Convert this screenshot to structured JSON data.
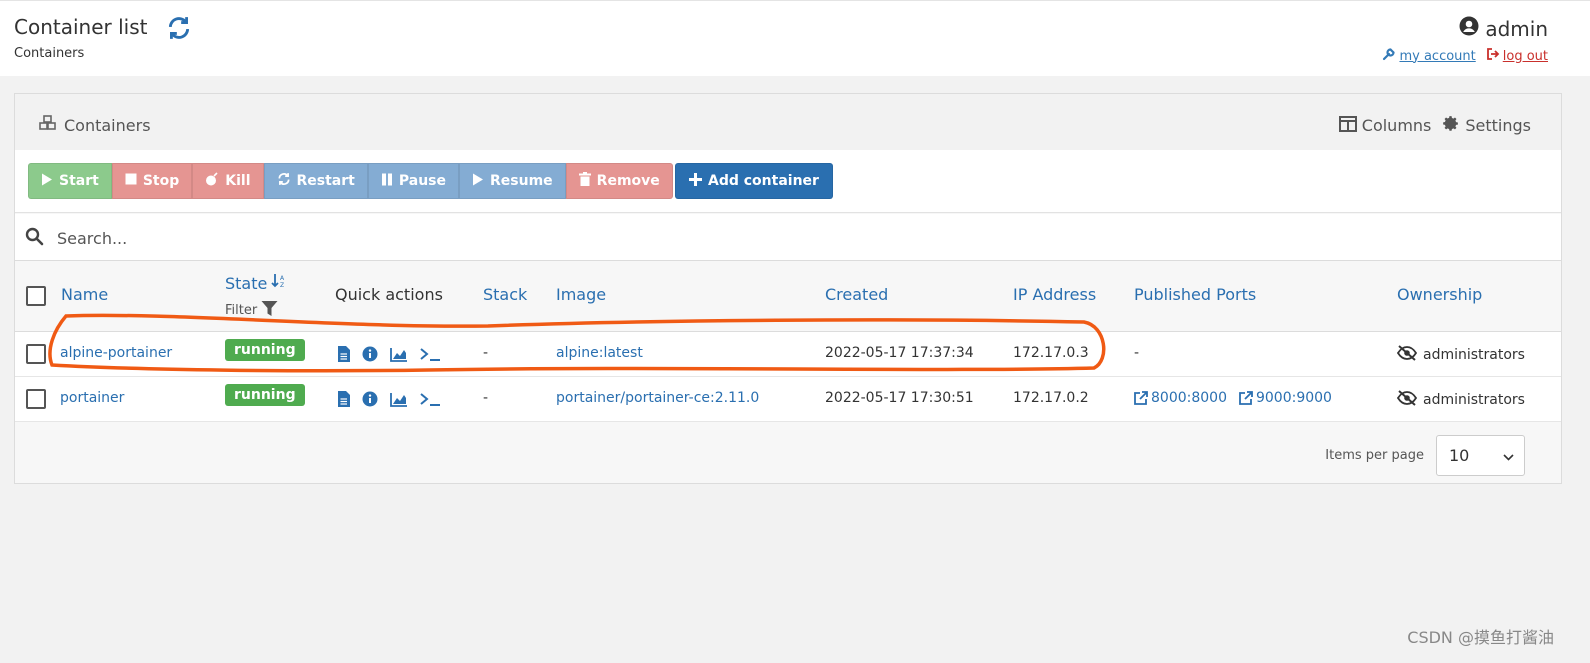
{
  "header": {
    "title": "Container list",
    "subtitle": "Containers",
    "user": "admin",
    "my_account": "my account",
    "log_out": "log out"
  },
  "panel": {
    "title": "Containers",
    "columns_label": "Columns",
    "settings_label": "Settings"
  },
  "toolbar": {
    "start": "Start",
    "stop": "Stop",
    "kill": "Kill",
    "restart": "Restart",
    "pause": "Pause",
    "resume": "Resume",
    "remove": "Remove",
    "add_container": "Add container"
  },
  "search": {
    "placeholder": "Search..."
  },
  "table": {
    "headers": {
      "name": "Name",
      "state": "State",
      "filter": "Filter",
      "quick_actions": "Quick actions",
      "stack": "Stack",
      "image": "Image",
      "created": "Created",
      "ip": "IP Address",
      "ports": "Published Ports",
      "ownership": "Ownership"
    },
    "rows": [
      {
        "name": "alpine-portainer",
        "state": "running",
        "stack": "-",
        "image": "alpine:latest",
        "created": "2022-05-17 17:37:34",
        "ip": "172.17.0.3",
        "ports_text": "-",
        "ownership": "administrators"
      },
      {
        "name": "portainer",
        "state": "running",
        "stack": "-",
        "image": "portainer/portainer-ce:2.11.0",
        "created": "2022-05-17 17:30:51",
        "ip": "172.17.0.2",
        "ports": [
          "8000:8000",
          "9000:9000"
        ],
        "ownership": "administrators"
      }
    ]
  },
  "pagination": {
    "label": "Items per page",
    "value": "10"
  },
  "watermark": "CSDN @摸鱼打酱油",
  "colors": {
    "primary": "#2a6fb0",
    "success": "#4fab4f",
    "danger": "#e59592",
    "annotation": "#f05a14"
  }
}
